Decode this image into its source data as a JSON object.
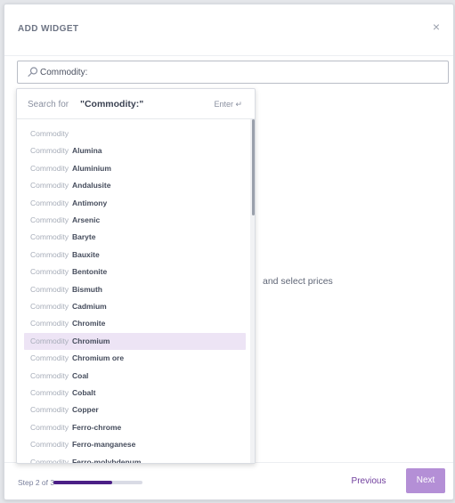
{
  "modal": {
    "title": "ADD WIDGET",
    "close_symbol": "×",
    "close_icon": "close-icon"
  },
  "search": {
    "icon": "search-icon",
    "value": "Commodity:",
    "placeholder": ""
  },
  "dropdown": {
    "prefix": "Search for",
    "term": "\"Commodity:\"",
    "enter_label": "Enter ↵",
    "items": [
      {
        "category": "Commodity",
        "name": ""
      },
      {
        "category": "Commodity",
        "name": "Alumina"
      },
      {
        "category": "Commodity",
        "name": "Aluminium"
      },
      {
        "category": "Commodity",
        "name": "Andalusite"
      },
      {
        "category": "Commodity",
        "name": "Antimony"
      },
      {
        "category": "Commodity",
        "name": "Arsenic"
      },
      {
        "category": "Commodity",
        "name": "Baryte"
      },
      {
        "category": "Commodity",
        "name": "Bauxite"
      },
      {
        "category": "Commodity",
        "name": "Bentonite"
      },
      {
        "category": "Commodity",
        "name": "Bismuth"
      },
      {
        "category": "Commodity",
        "name": "Cadmium"
      },
      {
        "category": "Commodity",
        "name": "Chromite"
      },
      {
        "category": "Commodity",
        "name": "Chromium"
      },
      {
        "category": "Commodity",
        "name": "Chromium ore"
      },
      {
        "category": "Commodity",
        "name": "Coal"
      },
      {
        "category": "Commodity",
        "name": "Cobalt"
      },
      {
        "category": "Commodity",
        "name": "Copper"
      },
      {
        "category": "Commodity",
        "name": "Ferro-chrome"
      },
      {
        "category": "Commodity",
        "name": "Ferro-manganese"
      },
      {
        "category": "Commodity",
        "name": "Ferro-molybdenum"
      }
    ],
    "highlighted_index": 12,
    "scroll_position": 0
  },
  "main": {
    "text": "and select prices"
  },
  "footer": {
    "step_text": "Step 2 of 3",
    "progress": 0.66,
    "previous_label": "Previous",
    "next_label": "Next"
  },
  "colors": {
    "accent": "#4b1f86",
    "next_button": "#b48fd6",
    "highlight": "#ede4f5"
  }
}
